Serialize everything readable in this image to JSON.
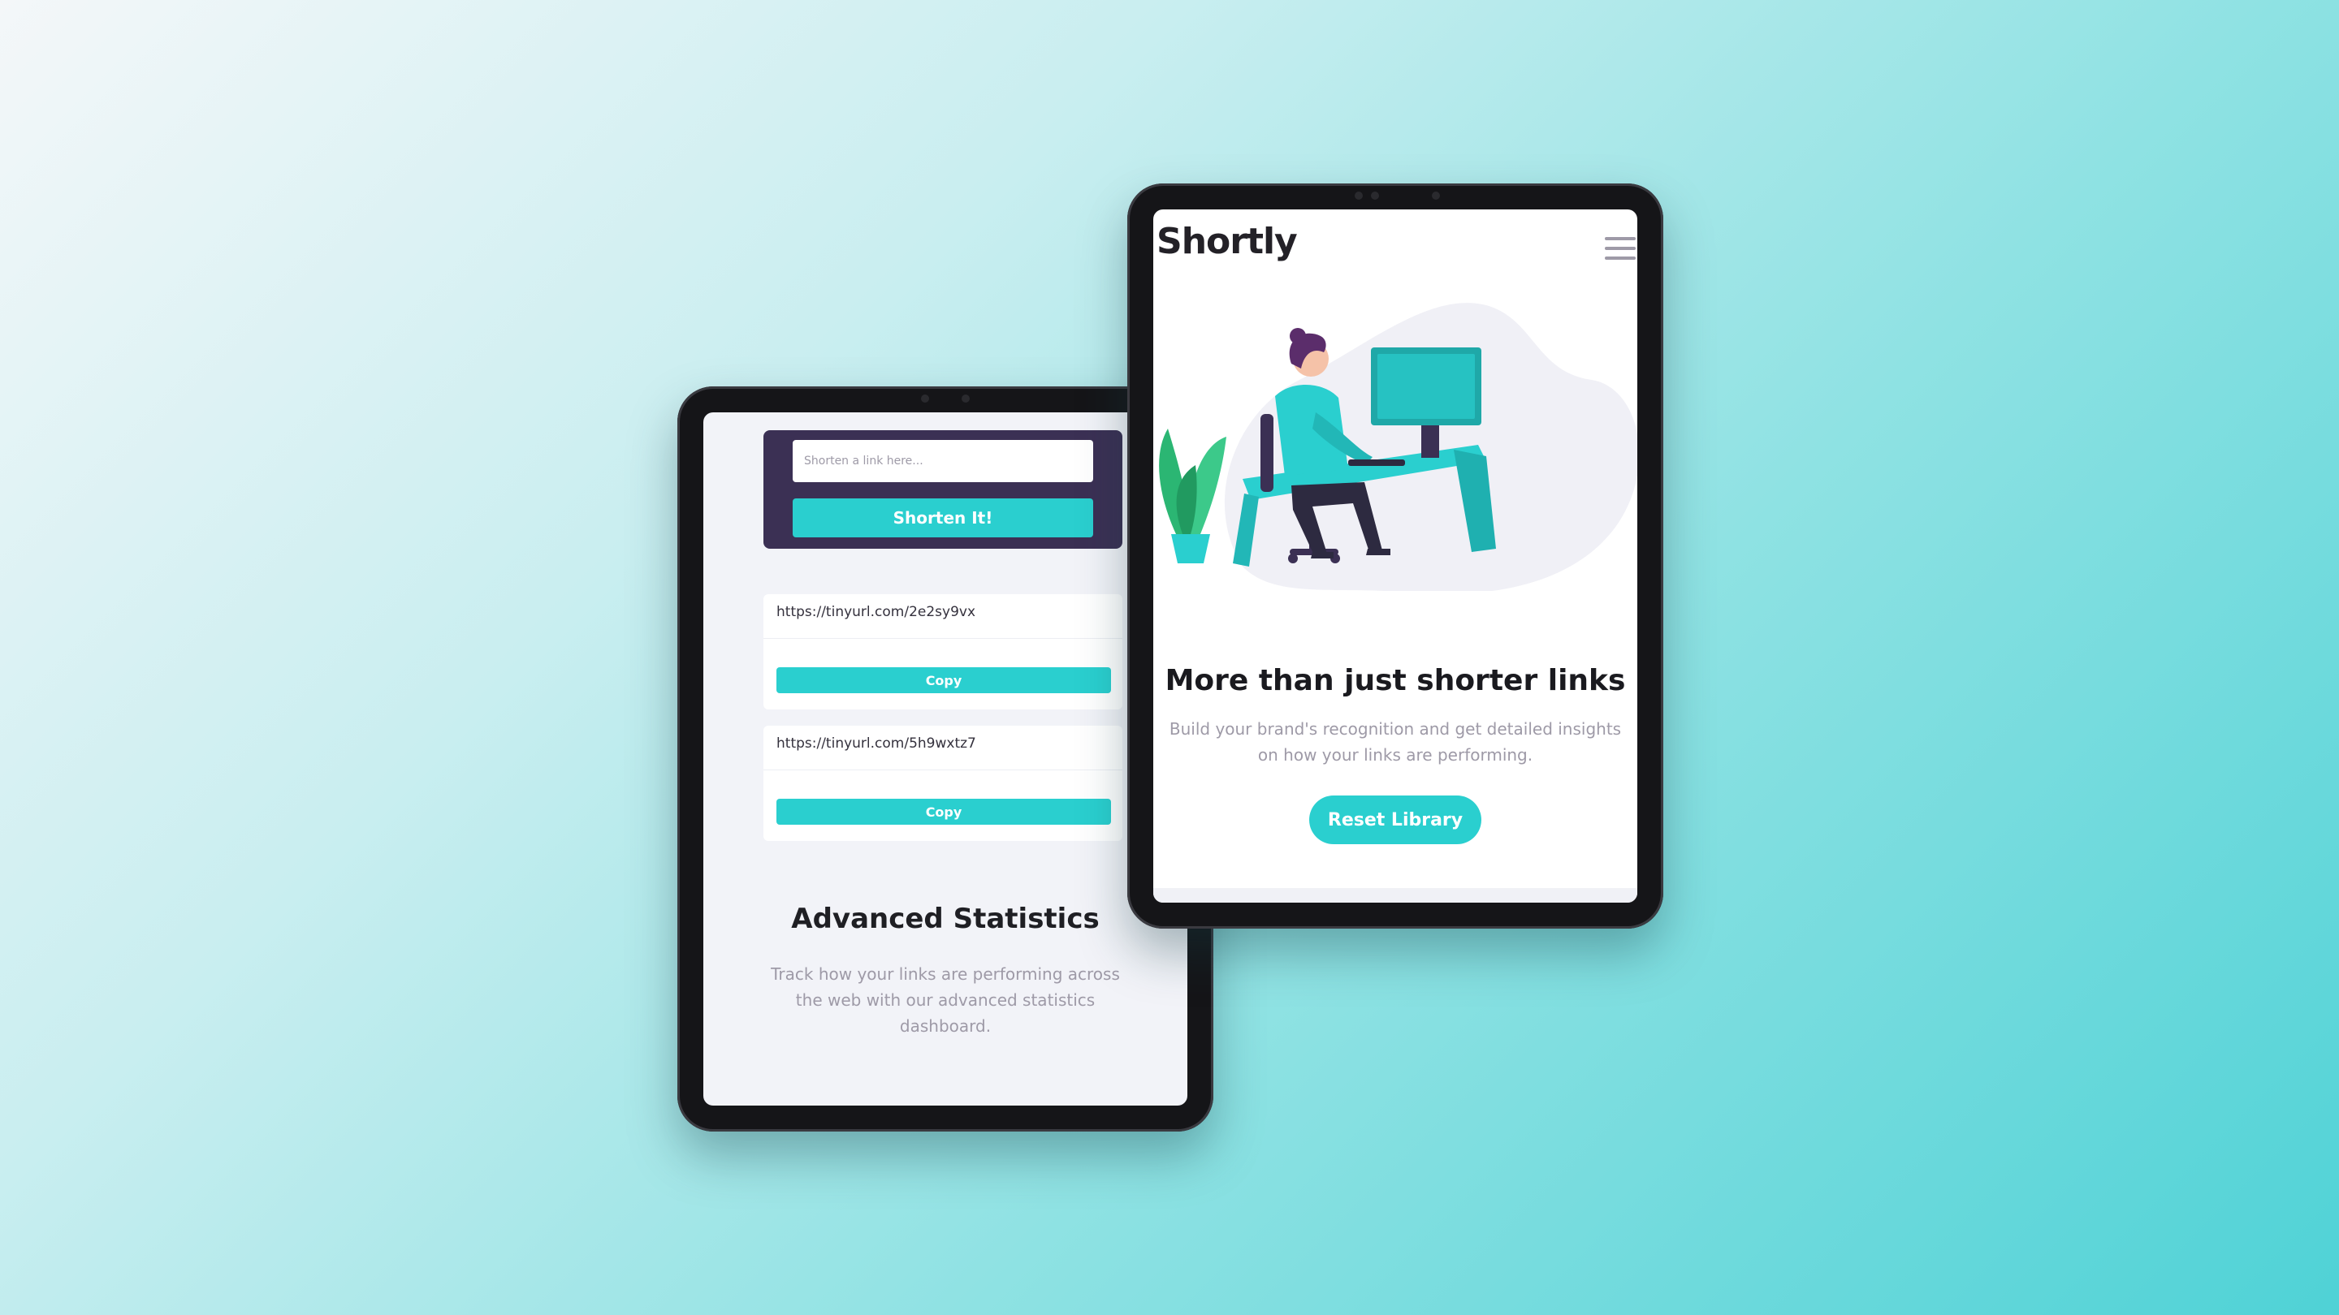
{
  "colors": {
    "accent": "#2acfcf",
    "dark_violet": "#3b3054",
    "text_dark": "#232127",
    "text_gray": "#9e9aa7"
  },
  "left_tablet": {
    "shorten_form": {
      "placeholder": "Shorten a link here...",
      "button_label": "Shorten It!"
    },
    "links": [
      {
        "url": "https://tinyurl.com/2e2sy9vx",
        "copy_label": "Copy"
      },
      {
        "url": "https://tinyurl.com/5h9wxtz7",
        "copy_label": "Copy"
      }
    ],
    "stats": {
      "title": "Advanced Statistics",
      "description": "Track how your links are performing across the web with our advanced statistics dashboard."
    }
  },
  "right_tablet": {
    "header": {
      "logo": "Shortly",
      "menu_icon": "hamburger-menu-icon"
    },
    "illustration": "person-working-at-desk-illustration",
    "hero": {
      "title": "More than just shorter links",
      "description": "Build your brand's recognition and get detailed insights on how your links are performing.",
      "button_label": "Reset Library"
    }
  }
}
